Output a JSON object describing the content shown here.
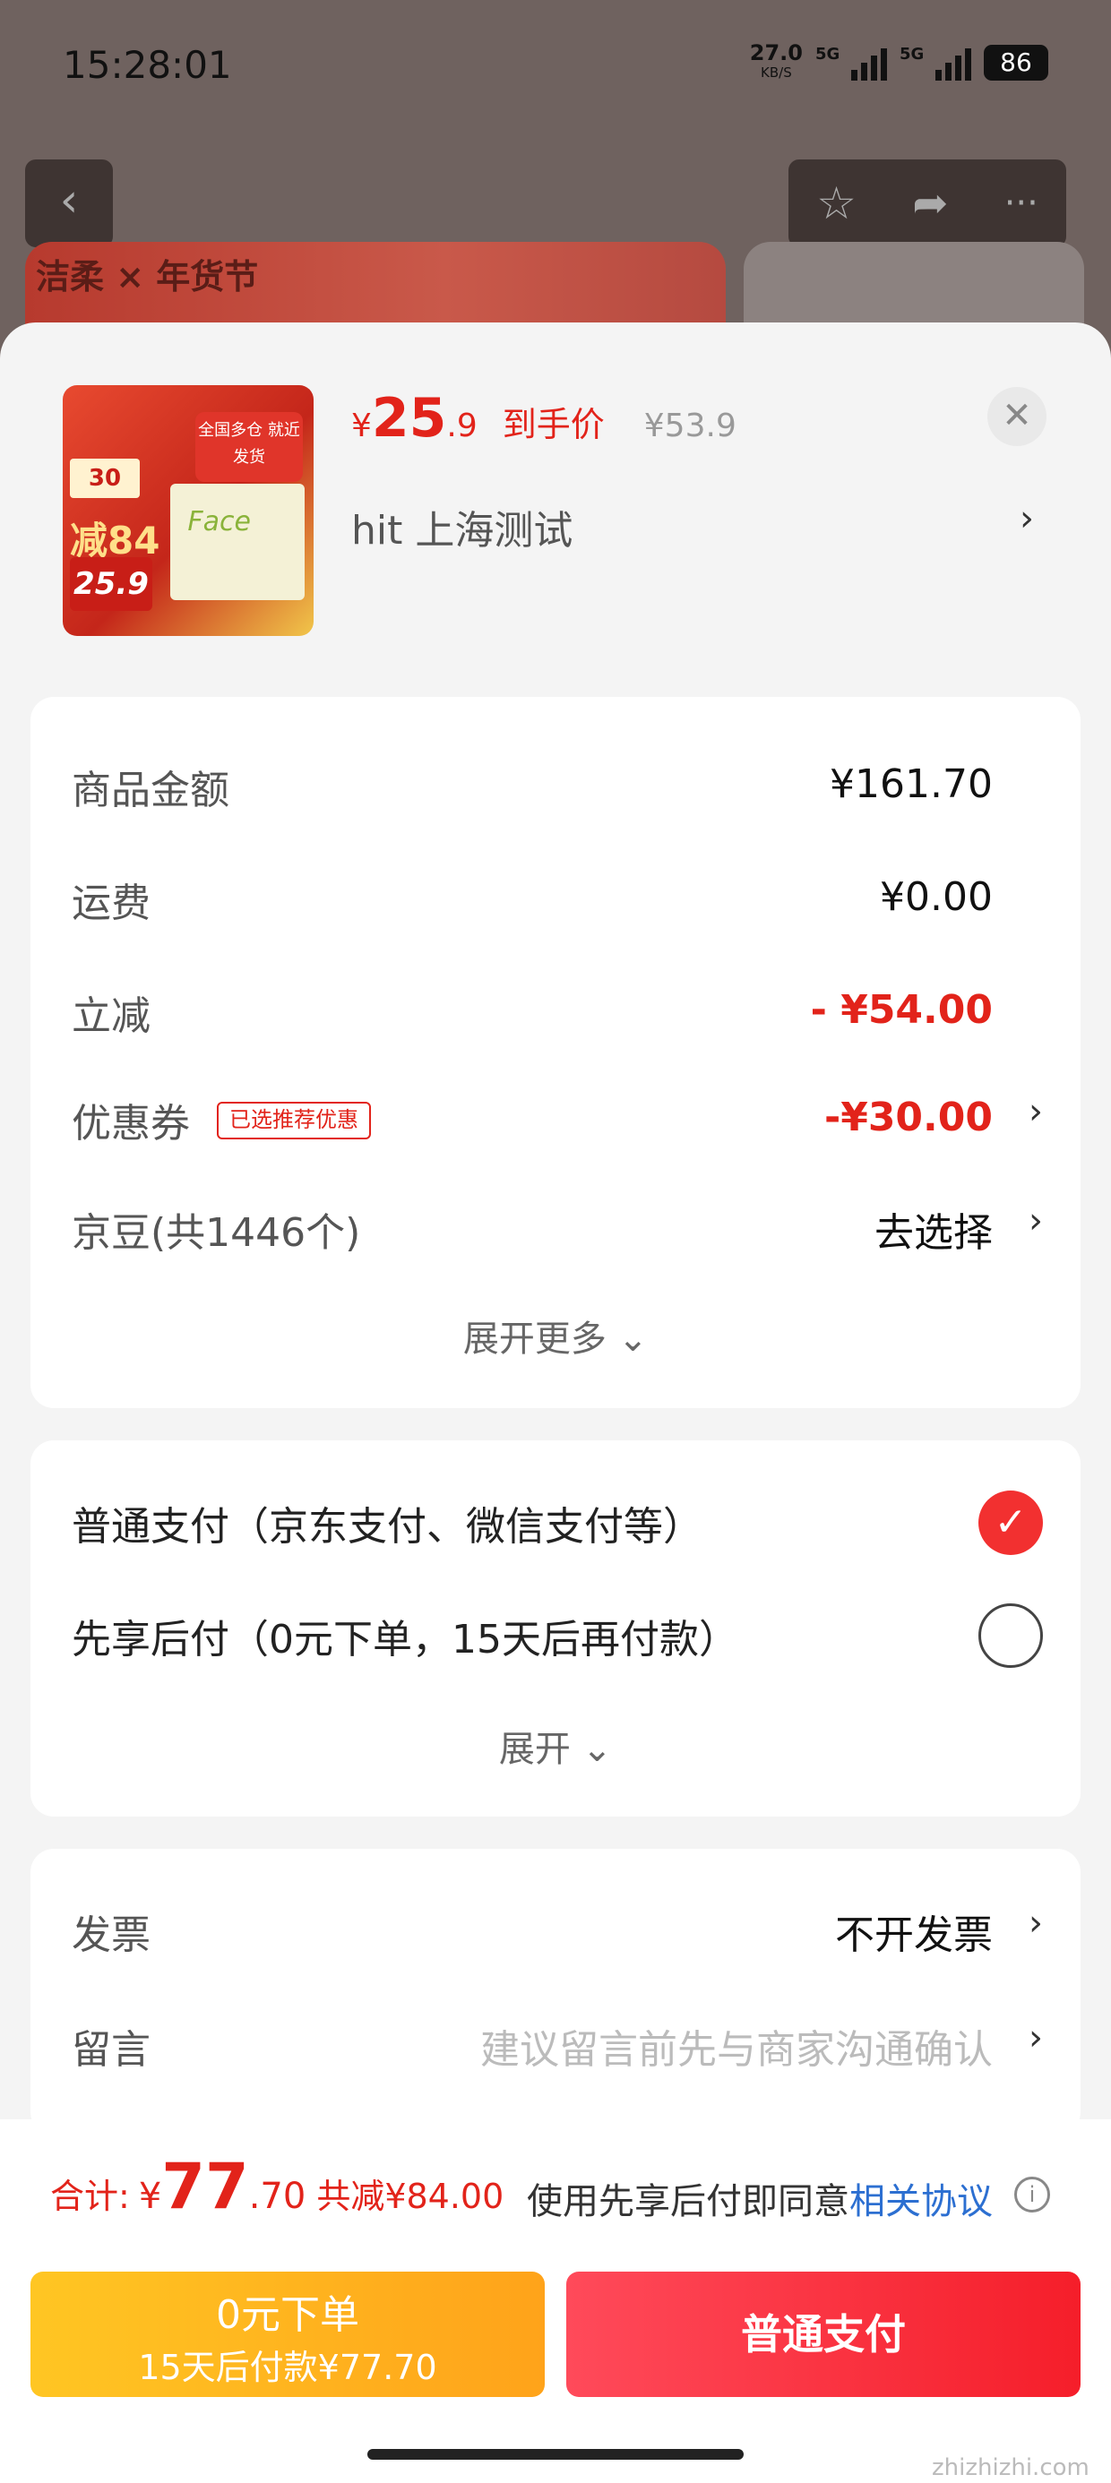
{
  "status": {
    "time": "15:28:01",
    "net_speed": "27.0",
    "net_unit": "KB/S",
    "sig1": "5G",
    "sig2": "5G",
    "battery": "86"
  },
  "background": {
    "banner_text": "洁柔 × 年货节"
  },
  "product": {
    "currency": "¥",
    "price_int": "25",
    "price_dec": ".9",
    "price_label": "到手价",
    "original_price": "¥53.9",
    "spec": "hit  上海测试",
    "thumb": {
      "tag": "30",
      "minus": "减84",
      "badge": "25.9",
      "brand": "Face",
      "flag": "全国多仓 就近发货"
    }
  },
  "summary": {
    "rows": [
      {
        "label": "商品金额",
        "value": "¥161.70"
      },
      {
        "label": "运费",
        "value": "¥0.00"
      },
      {
        "label": "立减",
        "value": "- ¥54.00"
      },
      {
        "label": "优惠券",
        "tag": "已选推荐优惠",
        "value": "-¥30.00"
      },
      {
        "label": "京豆(共1446个)",
        "value": "去选择"
      }
    ],
    "expand": "展开更多 ⌄"
  },
  "payment": {
    "options": [
      {
        "label": "普通支付（京东支付、微信支付等）",
        "selected": true
      },
      {
        "label": "先享后付（0元下单，15天后再付款）",
        "selected": false
      }
    ],
    "expand": "展开 ⌄"
  },
  "extras": {
    "rows": [
      {
        "label": "发票",
        "value": "不开发票"
      },
      {
        "label": "留言",
        "value": "建议留言前先与商家沟通确认"
      }
    ]
  },
  "bottom": {
    "total_label": "合计:",
    "currency": "¥",
    "total_int": "77",
    "total_dec": ".70",
    "saved": "共减¥84.00",
    "agree_text": "使用先享后付即同意",
    "agree_link": "相关协议",
    "btn_left_line1": "0元下单",
    "btn_left_line2": "15天后付款¥77.70",
    "btn_right": "普通支付"
  },
  "watermark": "zhizhizhi.com",
  "colors": {
    "accent_red": "#e2231a",
    "pay_gold": "#ffb21e",
    "link_blue": "#2c6fd1"
  }
}
